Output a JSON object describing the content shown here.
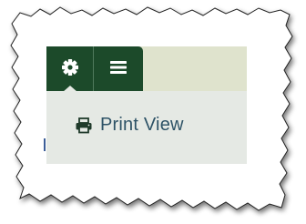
{
  "toolbar": {
    "settings_icon": "gear-icon",
    "menu_icon": "hamburger-menu-icon",
    "button_color": "#1c4a2a",
    "bar_color": "#dfe3cd"
  },
  "dropdown": {
    "items": [
      {
        "label": "Print View",
        "icon": "printer-icon"
      }
    ],
    "background": "#e5e9e4",
    "text_color": "#2d5266"
  }
}
